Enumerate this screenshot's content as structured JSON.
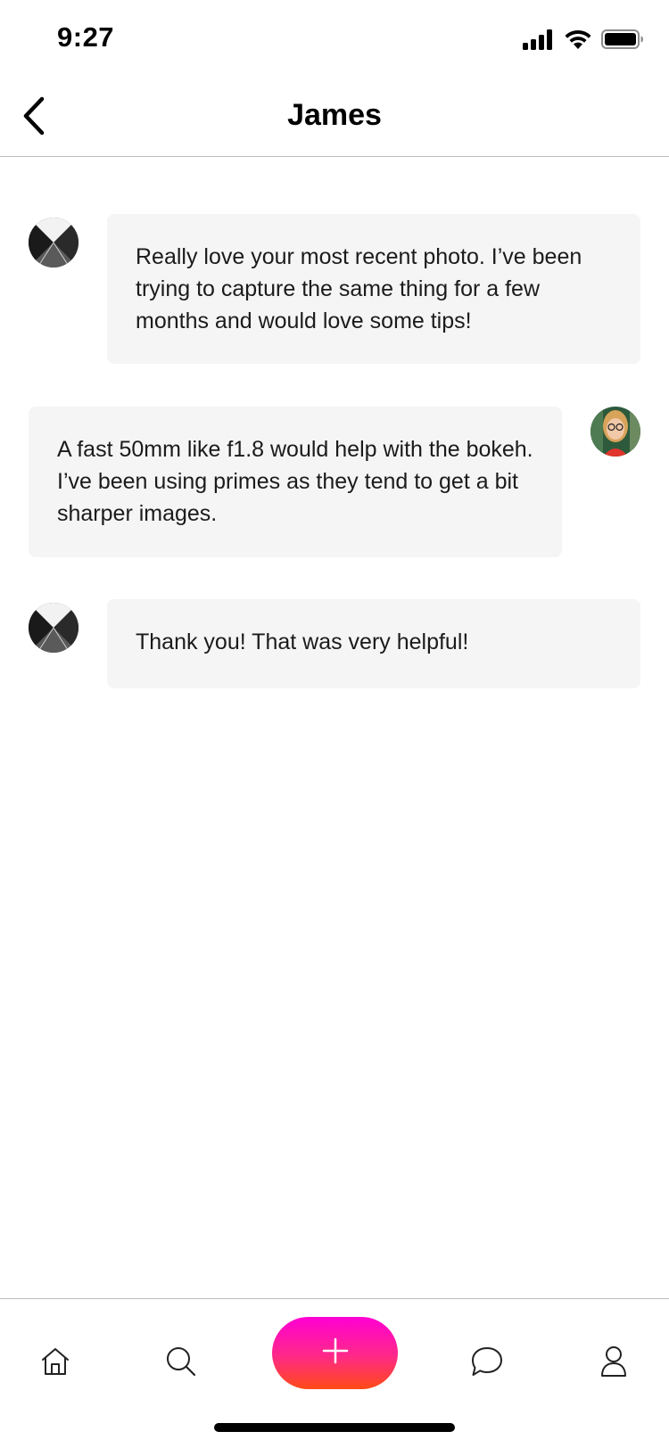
{
  "status_bar": {
    "time": "9:27",
    "icons": [
      "cellular-signal-icon",
      "wifi-icon",
      "battery-icon"
    ]
  },
  "header": {
    "title": "James",
    "back_icon": "chevron-left-icon"
  },
  "messages": [
    {
      "sender": "James",
      "direction": "incoming",
      "text": "Really love your most recent photo. I’ve been trying to capture the same thing for a few months and would love some tips!"
    },
    {
      "sender": "me",
      "direction": "outgoing",
      "text": "A fast 50mm like f1.8 would help with the bokeh. I’ve been using primes as they tend to get a bit sharper images."
    },
    {
      "sender": "James",
      "direction": "incoming",
      "text": "Thank you! That was very helpful!"
    }
  ],
  "tab_bar": {
    "tabs": [
      {
        "id": "home",
        "icon": "home-icon"
      },
      {
        "id": "search",
        "icon": "search-icon"
      },
      {
        "id": "create",
        "icon": "plus-icon"
      },
      {
        "id": "messages",
        "icon": "chat-bubble-icon"
      },
      {
        "id": "profile",
        "icon": "user-icon"
      }
    ],
    "create_gradient": [
      "#ff00d4",
      "#ff4a16"
    ]
  },
  "colors": {
    "bubble_bg": "#f5f5f5",
    "divider": "#bdbdbd"
  }
}
